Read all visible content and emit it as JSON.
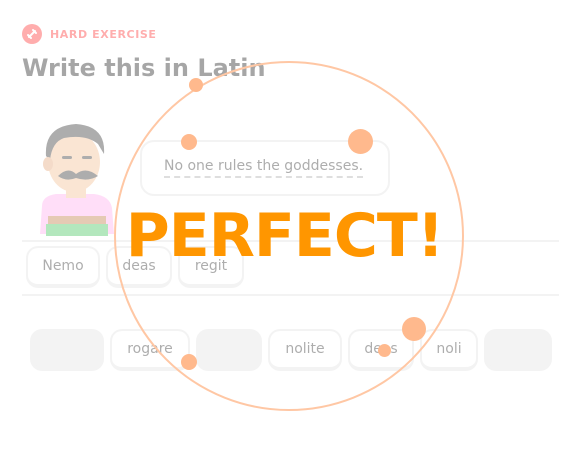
{
  "exercise": {
    "tag": "HARD EXERCISE",
    "title": "Write this in Latin",
    "accent_color": "#ff4b4b"
  },
  "prompt": {
    "sentence": "No one rules the goddesses."
  },
  "answer": {
    "words": [
      "Nemo",
      "deas",
      "regit"
    ]
  },
  "word_bank": {
    "words": [
      "",
      "rogare",
      "",
      "nolite",
      "deos",
      "noli",
      ""
    ]
  },
  "feedback": {
    "message": "PERFECT!",
    "color": "#ff9600"
  },
  "icons": {
    "tag_icon": "dumbbell-icon"
  }
}
